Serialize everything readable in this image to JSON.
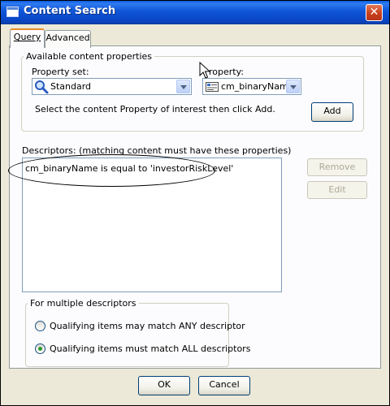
{
  "window": {
    "title": "Content Search",
    "close_glyph": "✕"
  },
  "tabs": [
    {
      "label": "Query",
      "active": true
    },
    {
      "label": "Advanced",
      "active": false
    }
  ],
  "available_properties": {
    "group_label": "Available content properties",
    "property_set_label": "Property set:",
    "property_set_value": "Standard",
    "property_label": "roperty:",
    "property_value": "cm_binaryName",
    "instruction": "Select the content Property of interest then click Add.",
    "add_label": "Add"
  },
  "descriptors": {
    "label": "Descriptors:  (matching content must have these properties)",
    "items": [
      "cm_binaryName is equal to 'investorRiskLevel'"
    ],
    "remove_label": "Remove",
    "edit_label": "Edit"
  },
  "multiple": {
    "group_label": "For multiple descriptors",
    "option_any": "Qualifying items may match ANY descriptor",
    "option_all": "Qualifying items must match ALL descriptors",
    "selected": "all"
  },
  "footer": {
    "ok_label": "OK",
    "cancel_label": "Cancel"
  },
  "icons": {
    "property_set": "magnifier-icon",
    "property": "property-field-icon",
    "cursor": "mouse-pointer-icon"
  }
}
